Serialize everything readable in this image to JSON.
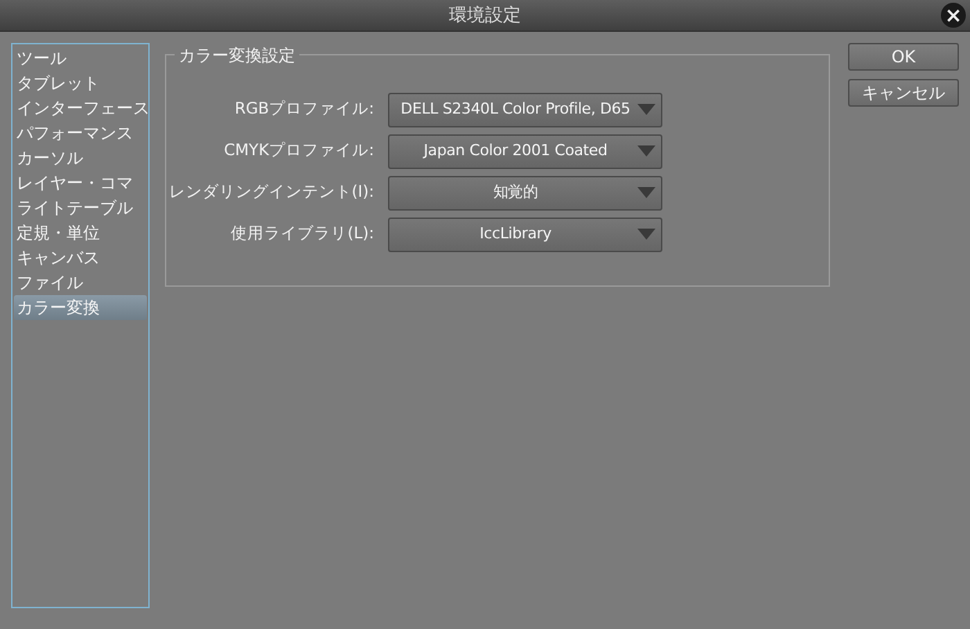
{
  "window": {
    "title": "環境設定",
    "close": "×"
  },
  "sidebar": {
    "items": [
      {
        "label": "ツール",
        "selected": false
      },
      {
        "label": "タブレット",
        "selected": false
      },
      {
        "label": "インターフェース",
        "selected": false
      },
      {
        "label": "パフォーマンス",
        "selected": false
      },
      {
        "label": "カーソル",
        "selected": false
      },
      {
        "label": "レイヤー・コマ",
        "selected": false
      },
      {
        "label": "ライトテーブル",
        "selected": false
      },
      {
        "label": "定規・単位",
        "selected": false
      },
      {
        "label": "キャンバス",
        "selected": false
      },
      {
        "label": "ファイル",
        "selected": false
      },
      {
        "label": "カラー変換",
        "selected": true
      }
    ]
  },
  "group": {
    "title": "カラー変換設定",
    "fields": [
      {
        "label": "RGBプロファイル:",
        "value": "DELL S2340L Color Profile, D65"
      },
      {
        "label": "CMYKプロファイル:",
        "value": "Japan Color 2001 Coated"
      },
      {
        "label": "レンダリングインテント(I):",
        "value": "知覚的"
      },
      {
        "label": "使用ライブラリ(L):",
        "value": "IccLibrary"
      }
    ]
  },
  "buttons": [
    "OK",
    "キャンセル"
  ]
}
